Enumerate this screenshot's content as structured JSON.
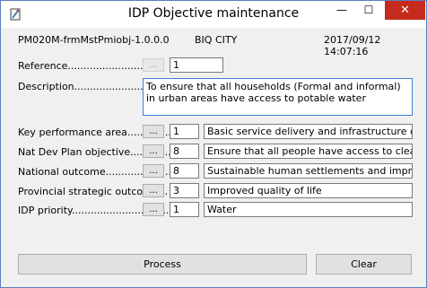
{
  "window": {
    "title": "IDP Objective maintenance",
    "minimize": "—",
    "maximize": "☐",
    "close": "✕"
  },
  "header": {
    "form_id": "PM020M-frmMstPmiobj-1.0.0.0",
    "city": "BIQ CITY",
    "datetime": "2017/09/12 14:07:16"
  },
  "fields": {
    "reference": {
      "label": "Reference",
      "dots": "...............................",
      "button": "...",
      "value": "1"
    },
    "description": {
      "label": "Description",
      "dots": "...............................",
      "value": "To ensure that all households (Formal and informal) in urban areas have access to potable water"
    },
    "kpa": {
      "label": "Key performance area",
      "dots": "...............",
      "button": "...",
      "code": "1",
      "text": "Basic service delivery and infrastructure developmen"
    },
    "ndp": {
      "label": "Nat Dev Plan objective",
      "dots": "..............",
      "button": "...",
      "code": "8",
      "text": "Ensure that all people have access to clean potable w"
    },
    "national": {
      "label": "National outcome",
      "dots": "......................",
      "button": "...",
      "code": "8",
      "text": "Sustainable human settlements and improved quality"
    },
    "provincial": {
      "label": "Provincial strategic outcome",
      "dots": "...",
      "button": "...",
      "code": "3",
      "text": "Improved quality of life"
    },
    "idp": {
      "label": "IDP priority",
      "dots": "...............................",
      "button": "...",
      "code": "1",
      "text": "Water"
    }
  },
  "actions": {
    "process": "Process",
    "clear": "Clear"
  },
  "colors": {
    "close_bg": "#c42b1c",
    "focus_border": "#3c7fd6"
  }
}
